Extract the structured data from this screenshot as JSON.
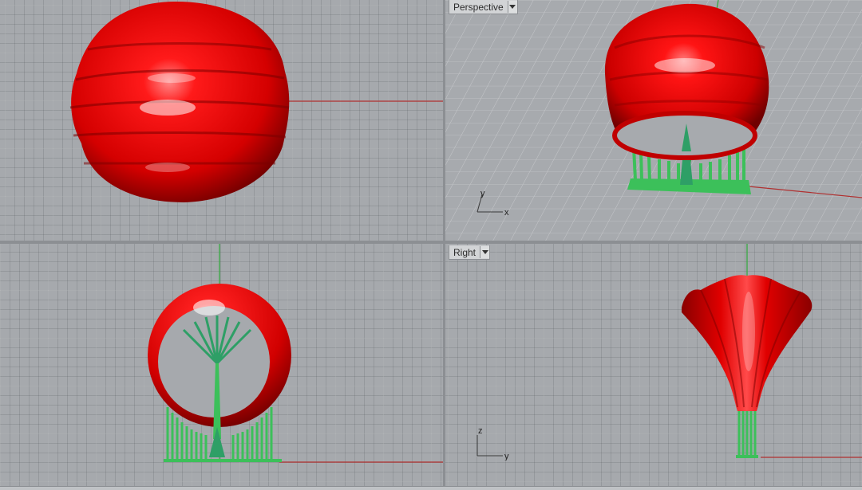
{
  "viewports": {
    "top": {
      "label": ""
    },
    "perspective": {
      "label": "Perspective",
      "axis_x": "x",
      "axis_y": "y"
    },
    "front": {
      "label": ""
    },
    "right": {
      "label": "Right",
      "axis_z": "z",
      "axis_y": "y"
    }
  },
  "colors": {
    "model_red": "#e0000a",
    "support_green": "#3cc05a",
    "x_axis": "#b03030",
    "y_axis": "#2fa83a",
    "grid_bg": "#a6a9ad"
  }
}
